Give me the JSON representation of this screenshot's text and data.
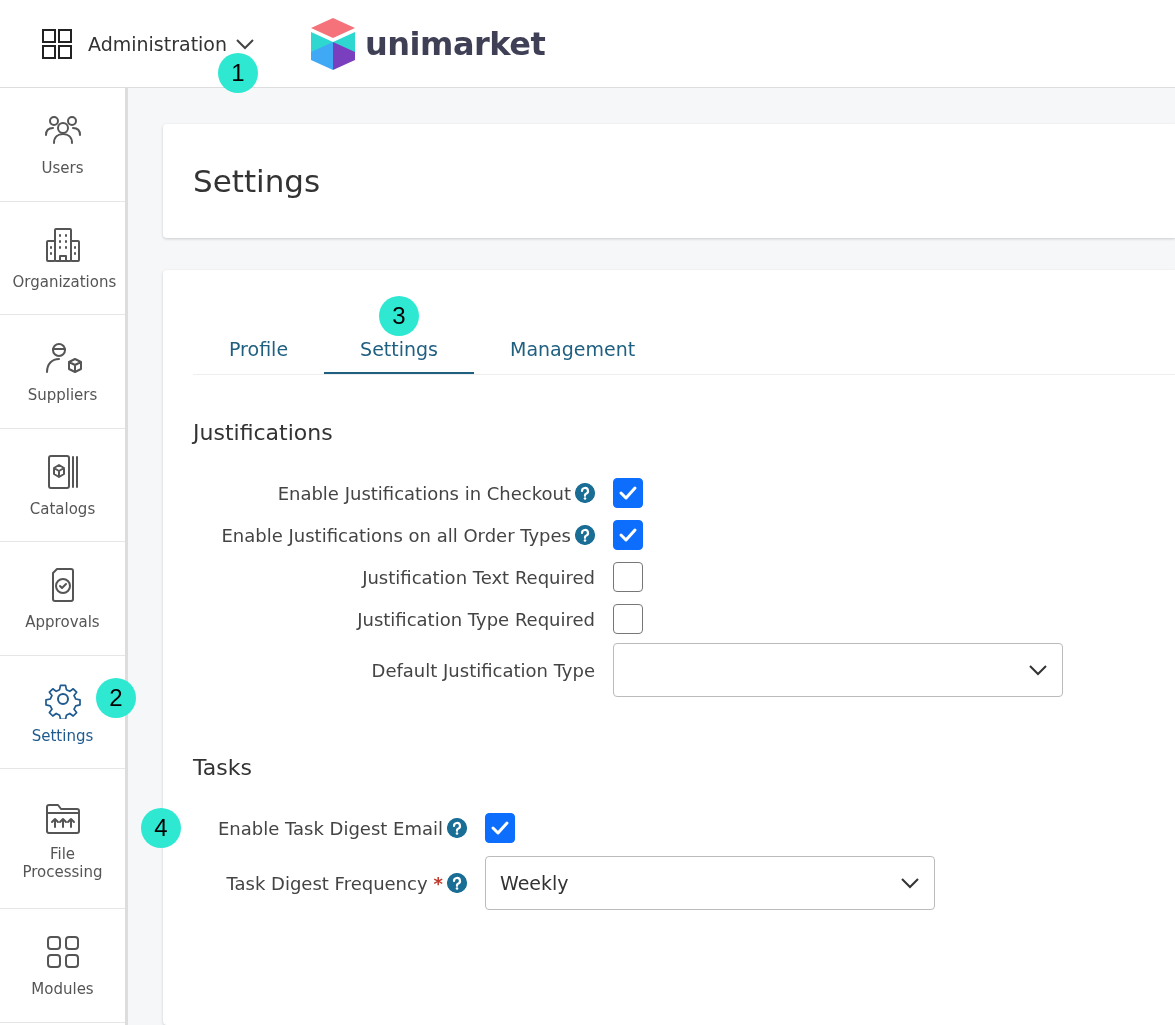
{
  "header": {
    "app_menu": "Administration",
    "callout": "1",
    "brand": "unimarket"
  },
  "sidebar": {
    "items": [
      {
        "label": "Users",
        "selected": false
      },
      {
        "label": "Organizations",
        "selected": false
      },
      {
        "label": "Suppliers",
        "selected": false
      },
      {
        "label": "Catalogs",
        "selected": false
      },
      {
        "label": "Approvals",
        "selected": false
      },
      {
        "label": "Settings",
        "selected": true,
        "callout": "2"
      },
      {
        "label": "File Processing",
        "selected": false
      },
      {
        "label": "Modules",
        "selected": false
      }
    ]
  },
  "page_title": "Settings",
  "tabs": [
    {
      "label": "Profile",
      "selected": false
    },
    {
      "label": "Settings",
      "selected": true,
      "callout": "3"
    },
    {
      "label": "Management",
      "selected": false
    }
  ],
  "sections": [
    {
      "title": "Justifications",
      "fields": [
        {
          "kind": "checkbox",
          "label": "Enable Justifications in Checkout",
          "help": true,
          "checked": true
        },
        {
          "kind": "checkbox",
          "label": "Enable Justifications on all Order Types",
          "help": true,
          "checked": true
        },
        {
          "kind": "checkbox",
          "label": "Justification Text Required",
          "help": false,
          "checked": false
        },
        {
          "kind": "checkbox",
          "label": "Justification Type Required",
          "help": false,
          "checked": false
        },
        {
          "kind": "select",
          "label": "Default Justification Type",
          "help": false
        }
      ]
    },
    {
      "title": "Tasks",
      "fields": [
        {
          "kind": "checkbox",
          "label": "Enable Task Digest Email",
          "help": true,
          "checked": true,
          "callout": "4"
        },
        {
          "kind": "select",
          "label": "Task Digest Frequency",
          "help": true,
          "required_mark": "*",
          "value": "Weekly"
        }
      ]
    }
  ]
}
